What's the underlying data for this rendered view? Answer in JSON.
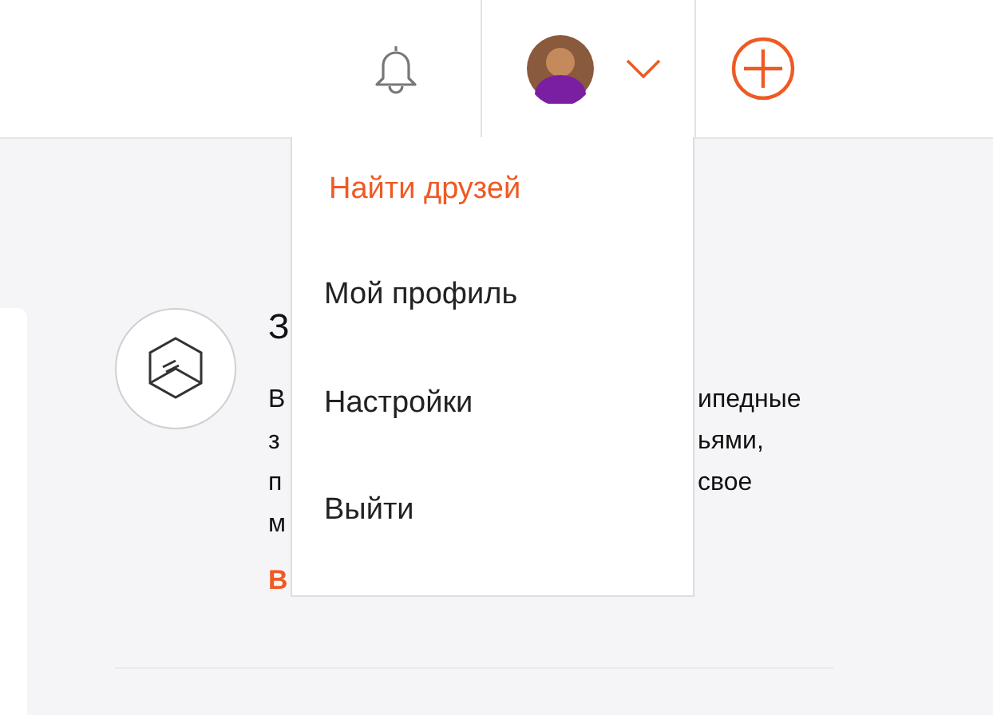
{
  "header": {
    "menu_expanded": true
  },
  "menu": {
    "items": [
      {
        "label": "Найти друзей",
        "selected": true
      },
      {
        "label": "Мой профиль",
        "selected": false
      },
      {
        "label": "Настройки",
        "selected": false
      },
      {
        "label": "Выйти",
        "selected": false
      }
    ]
  },
  "card": {
    "heading": "З",
    "lines": [
      {
        "left": "В",
        "right": "ипедные"
      },
      {
        "left": "з",
        "right": "ьями,"
      },
      {
        "left": "п",
        "right": "свое"
      },
      {
        "left": "м"
      }
    ],
    "link": "В"
  }
}
